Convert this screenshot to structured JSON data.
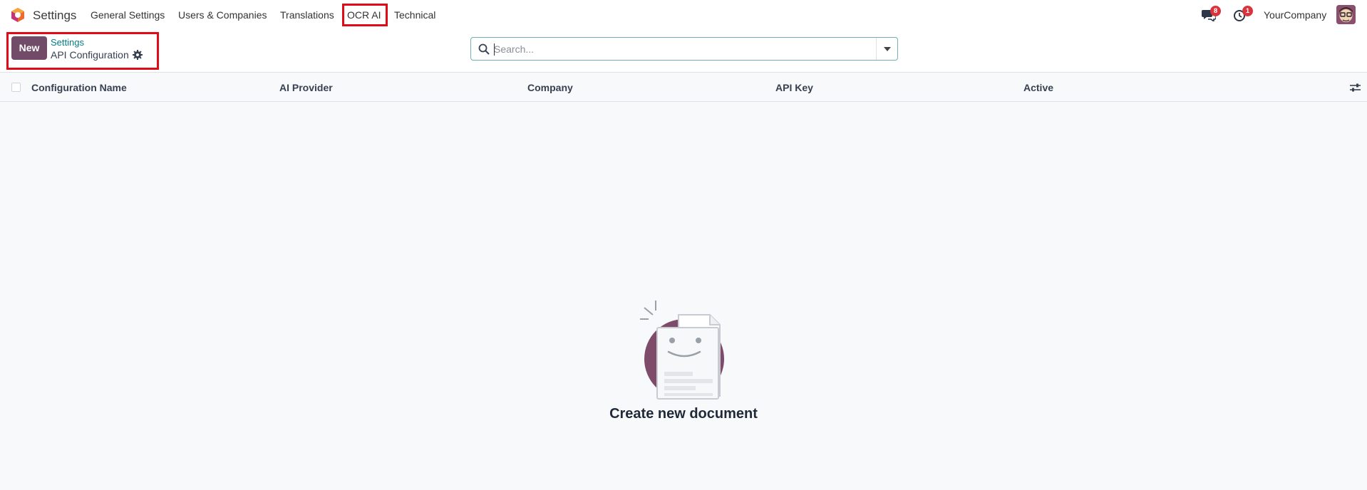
{
  "navbar": {
    "app_name": "Settings",
    "menu": [
      {
        "label": "General Settings"
      },
      {
        "label": "Users & Companies"
      },
      {
        "label": "Translations"
      },
      {
        "label": "OCR AI"
      },
      {
        "label": "Technical"
      }
    ],
    "messages_badge": "8",
    "activities_badge": "1",
    "company": "YourCompany"
  },
  "control_panel": {
    "new_label": "New",
    "breadcrumb_parent": "Settings",
    "breadcrumb_current": "API Configuration",
    "search_placeholder": "Search..."
  },
  "list": {
    "columns": [
      "Configuration Name",
      "AI Provider",
      "Company",
      "API Key",
      "Active"
    ]
  },
  "empty_state": {
    "title": "Create new document"
  },
  "colors": {
    "brand": "#714b67",
    "link": "#017e84",
    "highlight": "#e10b17",
    "badge": "#d9343c"
  }
}
